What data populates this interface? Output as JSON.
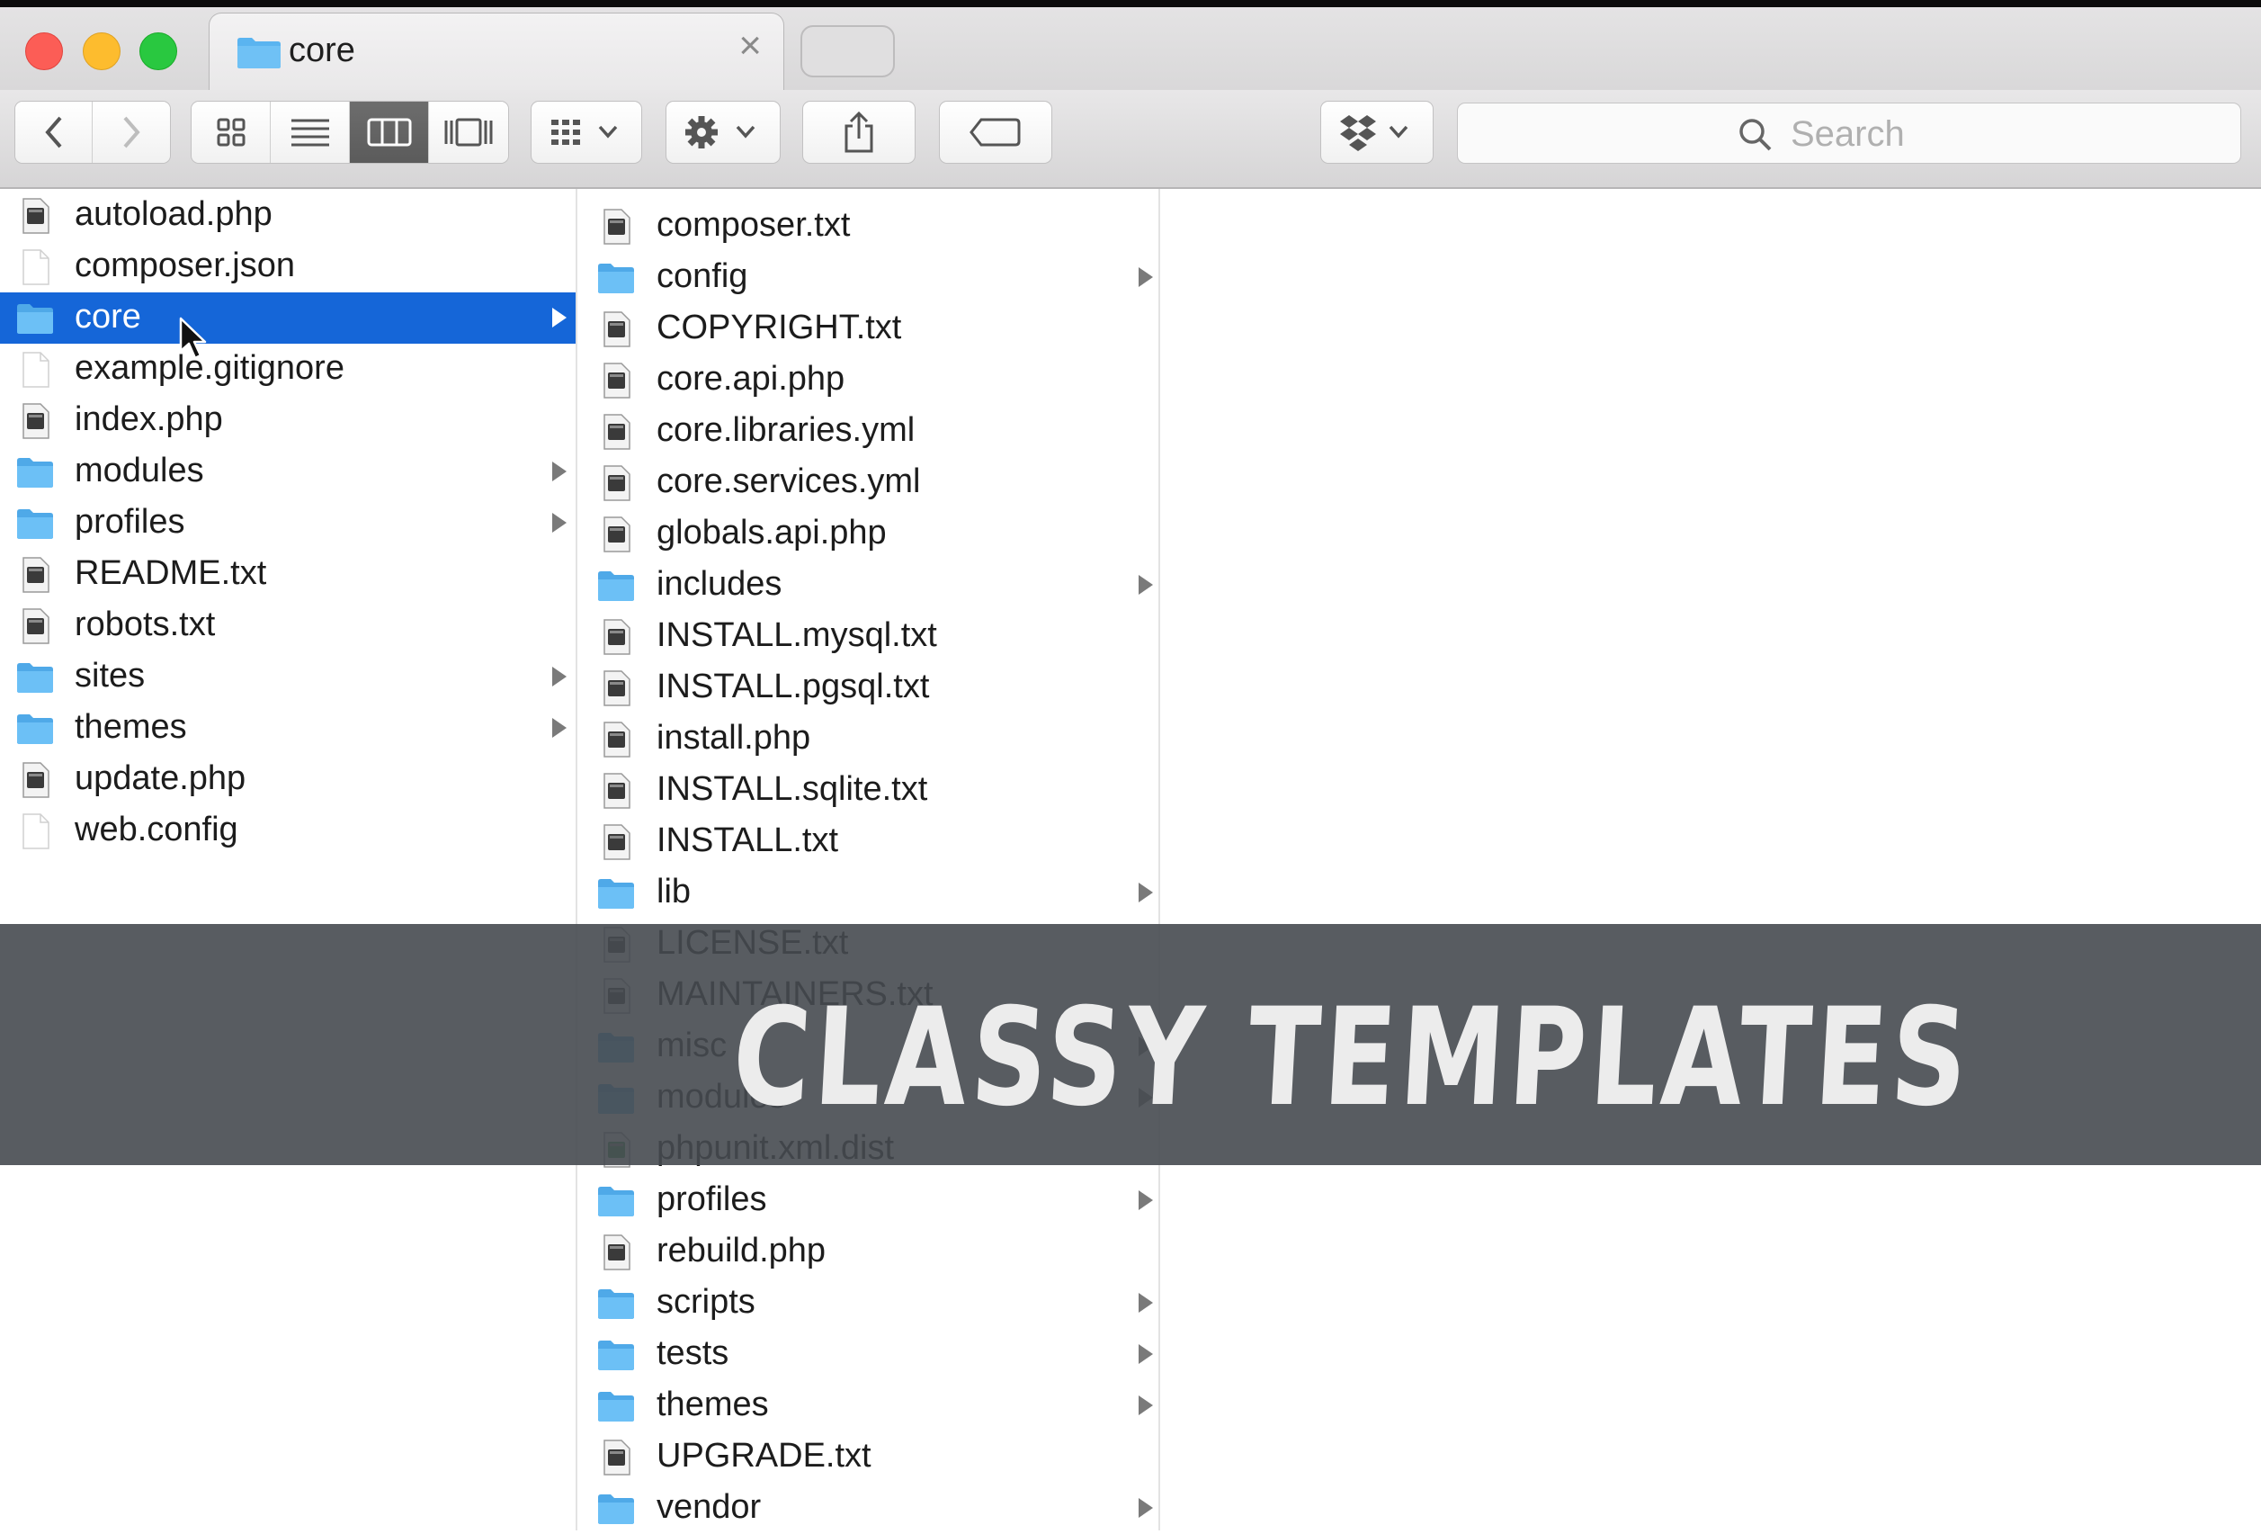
{
  "window": {
    "tab_title": "core",
    "tab_close": "×"
  },
  "toolbar": {
    "search_placeholder": "Search",
    "buttons": [
      "back-icon",
      "forward-icon",
      "icon-view-icon",
      "list-view-icon",
      "column-view-icon",
      "cover-flow-icon",
      "arrange-icon",
      "action-gear-icon",
      "share-icon",
      "tag-icon",
      "dropbox-icon"
    ],
    "active_view": "column"
  },
  "column1": {
    "items": [
      {
        "name": "autoload.php",
        "type": "file"
      },
      {
        "name": "composer.json",
        "type": "blank"
      },
      {
        "name": "core",
        "type": "folder",
        "selected": true
      },
      {
        "name": "example.gitignore",
        "type": "blank"
      },
      {
        "name": "index.php",
        "type": "file"
      },
      {
        "name": "modules",
        "type": "folder"
      },
      {
        "name": "profiles",
        "type": "folder"
      },
      {
        "name": "README.txt",
        "type": "file"
      },
      {
        "name": "robots.txt",
        "type": "file"
      },
      {
        "name": "sites",
        "type": "folder"
      },
      {
        "name": "themes",
        "type": "folder"
      },
      {
        "name": "update.php",
        "type": "file"
      },
      {
        "name": "web.config",
        "type": "blank"
      }
    ]
  },
  "column2": {
    "items": [
      {
        "name": "composer.txt",
        "type": "file"
      },
      {
        "name": "config",
        "type": "folder"
      },
      {
        "name": "COPYRIGHT.txt",
        "type": "file"
      },
      {
        "name": "core.api.php",
        "type": "file"
      },
      {
        "name": "core.libraries.yml",
        "type": "file"
      },
      {
        "name": "core.services.yml",
        "type": "file"
      },
      {
        "name": "globals.api.php",
        "type": "file"
      },
      {
        "name": "includes",
        "type": "folder"
      },
      {
        "name": "INSTALL.mysql.txt",
        "type": "file"
      },
      {
        "name": "INSTALL.pgsql.txt",
        "type": "file"
      },
      {
        "name": "install.php",
        "type": "file"
      },
      {
        "name": "INSTALL.sqlite.txt",
        "type": "file"
      },
      {
        "name": "INSTALL.txt",
        "type": "file"
      },
      {
        "name": "lib",
        "type": "folder"
      },
      {
        "name": "LICENSE.txt",
        "type": "file"
      },
      {
        "name": "MAINTAINERS.txt",
        "type": "file"
      },
      {
        "name": "misc",
        "type": "folder"
      },
      {
        "name": "modules",
        "type": "folder"
      },
      {
        "name": "phpunit.xml.dist",
        "type": "green"
      },
      {
        "name": "profiles",
        "type": "folder"
      },
      {
        "name": "rebuild.php",
        "type": "file"
      },
      {
        "name": "scripts",
        "type": "folder"
      },
      {
        "name": "tests",
        "type": "folder"
      },
      {
        "name": "themes",
        "type": "folder"
      },
      {
        "name": "UPGRADE.txt",
        "type": "file"
      },
      {
        "name": "vendor",
        "type": "folder"
      }
    ]
  },
  "watermark": {
    "text": "CLASSY TEMPLATES"
  },
  "colors": {
    "selection": "#1566d8",
    "folder": "#5ab4f0",
    "band": "#464a50"
  }
}
